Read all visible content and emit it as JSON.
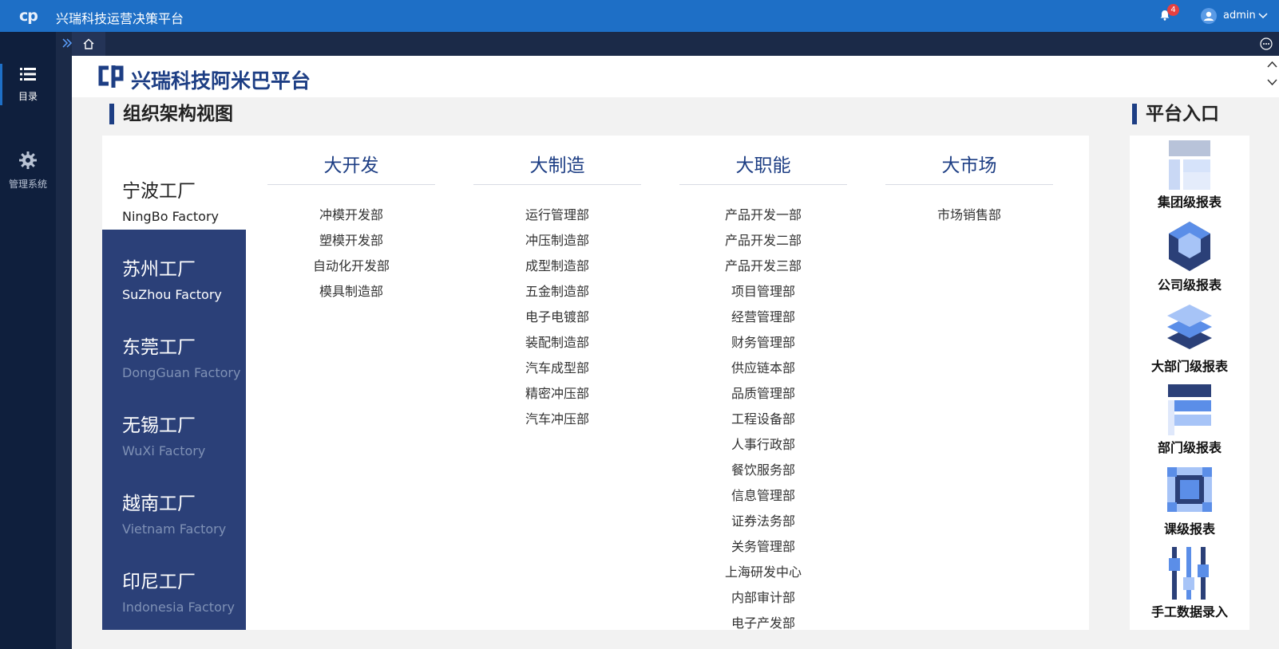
{
  "topbar": {
    "logo_mark": "cp",
    "app_title": "兴瑞科技运营决策平台",
    "notifications_count": "4",
    "user_name": "admin"
  },
  "sidebar": {
    "items": [
      {
        "label": "目录",
        "icon": "list-icon"
      },
      {
        "label": "管理系统",
        "icon": "gear-icon"
      }
    ]
  },
  "brand": {
    "name": "兴瑞科技阿米巴平台"
  },
  "sections": {
    "org_title": "组织架构视图",
    "entry_title": "平台入口"
  },
  "factories": [
    {
      "cn": "宁波工厂",
      "en": "NingBo Factory"
    },
    {
      "cn": "苏州工厂",
      "en": "SuZhou Factory"
    },
    {
      "cn": "东莞工厂",
      "en": "DongGuan Factory"
    },
    {
      "cn": "无锡工厂",
      "en": "WuXi Factory"
    },
    {
      "cn": "越南工厂",
      "en": "Vietnam Factory"
    },
    {
      "cn": "印尼工厂",
      "en": "Indonesia Factory"
    }
  ],
  "divisions": [
    {
      "title": "大开发",
      "depts": [
        "冲模开发部",
        "塑模开发部",
        "自动化开发部",
        "模具制造部"
      ]
    },
    {
      "title": "大制造",
      "depts": [
        "运行管理部",
        "冲压制造部",
        "成型制造部",
        "五金制造部",
        "电子电镀部",
        "装配制造部",
        "汽车成型部",
        "精密冲压部",
        "汽车冲压部"
      ]
    },
    {
      "title": "大职能",
      "depts": [
        "产品开发一部",
        "产品开发二部",
        "产品开发三部",
        "项目管理部",
        "经营管理部",
        "财务管理部",
        "供应链本部",
        "品质管理部",
        "工程设备部",
        "人事行政部",
        "餐饮服务部",
        "信息管理部",
        "证券法务部",
        "关务管理部",
        "上海研发中心",
        "内部审计部",
        "电子产发部"
      ]
    },
    {
      "title": "大市场",
      "depts": [
        "市场销售部"
      ]
    }
  ],
  "entries": [
    {
      "label": "集团级报表",
      "icon": "group-report-icon"
    },
    {
      "label": "公司级报表",
      "icon": "company-report-icon"
    },
    {
      "label": "大部门级报表",
      "icon": "division-report-icon"
    },
    {
      "label": "部门级报表",
      "icon": "department-report-icon"
    },
    {
      "label": "课级报表",
      "icon": "section-report-icon"
    },
    {
      "label": "手工数据录入",
      "icon": "manual-entry-icon"
    }
  ],
  "colors": {
    "topbar": "#1e6fc6",
    "sidebar": "#0f1f3d",
    "brand": "#1d3e84",
    "factory_panel": "#2b4078"
  }
}
